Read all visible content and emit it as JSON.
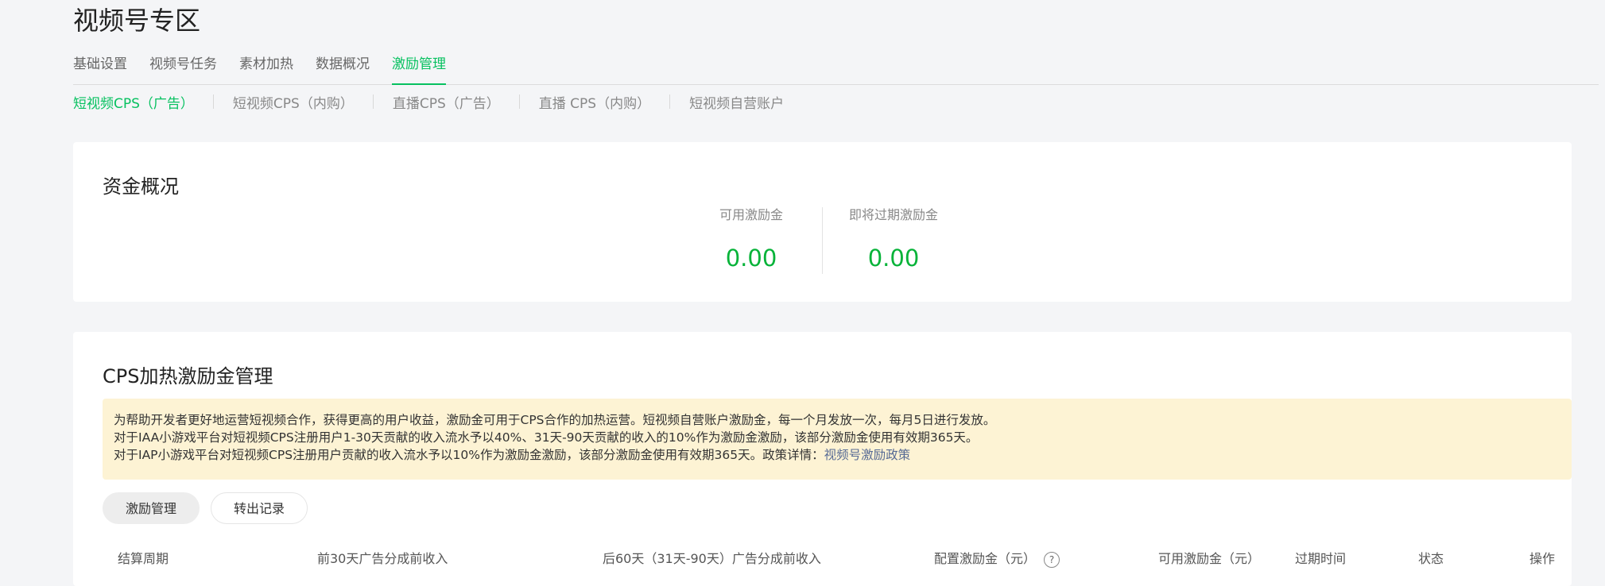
{
  "page": {
    "title": "视频号专区"
  },
  "tabs": [
    {
      "label": "基础设置"
    },
    {
      "label": "视频号任务"
    },
    {
      "label": "素材加热"
    },
    {
      "label": "数据概况"
    },
    {
      "label": "激励管理"
    }
  ],
  "active_tab": "激励管理",
  "subtabs": [
    {
      "label": "短视频CPS（广告）"
    },
    {
      "label": "短视频CPS（内购）"
    },
    {
      "label": "直播CPS（广告）"
    },
    {
      "label": "直播 CPS（内购）"
    },
    {
      "label": "短视频自营账户"
    }
  ],
  "active_subtab": "短视频CPS（广告）",
  "funds": {
    "title": "资金概况",
    "available_label": "可用激励金",
    "available_value": "0.00",
    "expiring_label": "即将过期激励金",
    "expiring_value": "0.00"
  },
  "cps": {
    "title": "CPS加热激励金管理",
    "notice_line1": "为帮助开发者更好地运营短视频合作，获得更高的用户收益，激励金可用于CPS合作的加热运营。短视频自营账户激励金，每一个月发放一次，每月5日进行发放。",
    "notice_line2": "对于IAA小游戏平台对短视频CPS注册用户1-30天贡献的收入流水予以40%、31天-90天贡献的收入的10%作为激励金激励，该部分激励金使用有效期365天。",
    "notice_line3": "对于IAP小游戏平台对短视频CPS注册用户贡献的收入流水予以10%作为激励金激励，该部分激励金使用有效期365天。政策详情：",
    "notice_link": "视频号激励政策",
    "pills": [
      {
        "label": "激励管理"
      },
      {
        "label": "转出记录"
      }
    ],
    "columns": [
      {
        "label": "结算周期"
      },
      {
        "label": "前30天广告分成前收入"
      },
      {
        "label": "后60天（31天-90天）广告分成前收入"
      },
      {
        "label": "配置激励金（元）"
      },
      {
        "label": "可用激励金（元）"
      },
      {
        "label": "过期时间"
      },
      {
        "label": "状态"
      },
      {
        "label": "操作"
      }
    ],
    "help_icon_text": "?"
  },
  "colors": {
    "accent": "#07c160",
    "value_green": "#07b339",
    "link": "#576b95",
    "notice_bg": "#fdf3d4"
  }
}
